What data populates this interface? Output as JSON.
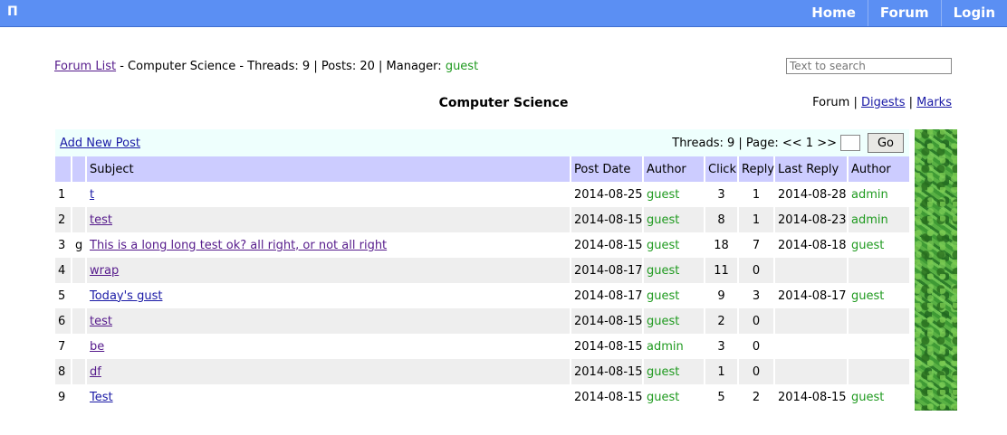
{
  "topbar": {
    "logo": "П",
    "nav": [
      "Home",
      "Forum",
      "Login"
    ]
  },
  "crumbs": {
    "forum_list": "Forum List",
    "sep": " - ",
    "board": "Computer Science",
    "threads_label": "Threads: 9",
    "posts_label": "Posts: 20",
    "manager_label": "Manager: ",
    "manager": "guest",
    "bar": " | "
  },
  "search": {
    "placeholder": "Text to search"
  },
  "board_title": "Computer Science",
  "views": {
    "forum": "Forum",
    "digests": "Digests",
    "marks": "Marks",
    "sep": " | "
  },
  "toolbar": {
    "add_post": "Add New Post",
    "threads": "Threads: 9 | Page: << 1 >>",
    "go": "Go"
  },
  "table": {
    "headers": [
      "",
      "",
      "Subject",
      "Post Date",
      "Author",
      "Click",
      "Reply",
      "Last Reply",
      "Author"
    ],
    "rows": [
      {
        "num": "1",
        "flag": "",
        "subject": "t",
        "date": "2014-08-25",
        "author": "guest",
        "click": "3",
        "reply": "1",
        "last": "2014-08-28",
        "last_author": "admin"
      },
      {
        "num": "2",
        "flag": "",
        "subject": "test",
        "date": "2014-08-15",
        "author": "guest",
        "click": "8",
        "reply": "1",
        "last": "2014-08-23",
        "last_author": "admin"
      },
      {
        "num": "3",
        "flag": "g",
        "subject": "This is a long long test ok? all right, or not all right",
        "date": "2014-08-15",
        "author": "guest",
        "click": "18",
        "reply": "7",
        "last": "2014-08-18",
        "last_author": "guest"
      },
      {
        "num": "4",
        "flag": "",
        "subject": "wrap",
        "date": "2014-08-17",
        "author": "guest",
        "click": "11",
        "reply": "0",
        "last": "",
        "last_author": ""
      },
      {
        "num": "5",
        "flag": "",
        "subject": "Today's gust",
        "date": "2014-08-17",
        "author": "guest",
        "click": "9",
        "reply": "3",
        "last": "2014-08-17",
        "last_author": "guest"
      },
      {
        "num": "6",
        "flag": "",
        "subject": "test",
        "date": "2014-08-15",
        "author": "guest",
        "click": "2",
        "reply": "0",
        "last": "",
        "last_author": ""
      },
      {
        "num": "7",
        "flag": "",
        "subject": "be",
        "date": "2014-08-15",
        "author": "admin",
        "click": "3",
        "reply": "0",
        "last": "",
        "last_author": ""
      },
      {
        "num": "8",
        "flag": "",
        "subject": "df",
        "date": "2014-08-15",
        "author": "guest",
        "click": "1",
        "reply": "0",
        "last": "",
        "last_author": ""
      },
      {
        "num": "9",
        "flag": "",
        "subject": "Test",
        "date": "2014-08-15",
        "author": "guest",
        "click": "5",
        "reply": "2",
        "last": "2014-08-15",
        "last_author": "guest"
      }
    ]
  }
}
